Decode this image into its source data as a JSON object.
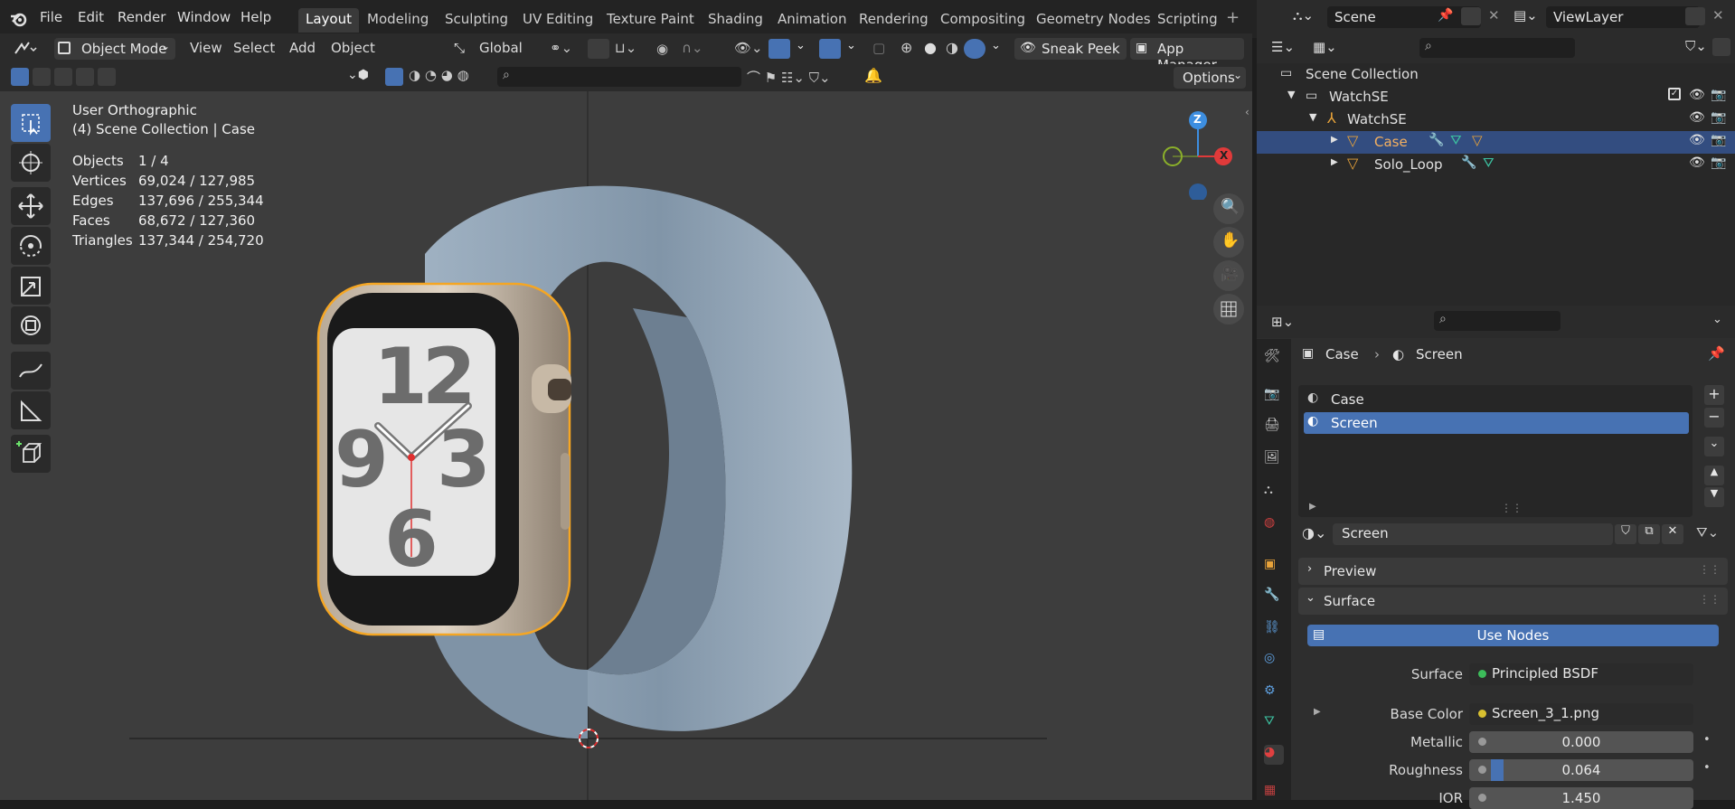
{
  "menu": [
    "File",
    "Edit",
    "Render",
    "Window",
    "Help"
  ],
  "workspaces": [
    "Layout",
    "Modeling",
    "Sculpting",
    "UV Editing",
    "Texture Paint",
    "Shading",
    "Animation",
    "Rendering",
    "Compositing",
    "Geometry Nodes",
    "Scripting"
  ],
  "active_workspace": "Layout",
  "scene": {
    "name": "Scene",
    "view_layer": "ViewLayer"
  },
  "viewport_header": {
    "mode": "Object Mode",
    "view": "View",
    "select": "Select",
    "add": "Add",
    "object": "Object",
    "transform": "Global",
    "sneak_peek": "Sneak Peek",
    "app_manager": "App Manager",
    "options": "Options"
  },
  "viewport_info": {
    "view_name": "User Orthographic",
    "collection": "(4) Scene Collection | Case",
    "stats": [
      {
        "label": "Objects",
        "value": "1 / 4"
      },
      {
        "label": "Vertices",
        "value": "69,024 / 127,985"
      },
      {
        "label": "Edges",
        "value": "137,696 / 255,344"
      },
      {
        "label": "Faces",
        "value": "68,672 / 127,360"
      },
      {
        "label": "Triangles",
        "value": "137,344 / 254,720"
      }
    ]
  },
  "gizmo": {
    "z": "Z",
    "x": "X"
  },
  "watch_face": {
    "n12": "12",
    "n9": "9",
    "n3": "3",
    "n6": "6"
  },
  "outliner": {
    "root": "Scene Collection",
    "rows": [
      "WatchSE",
      "WatchSE",
      "Case",
      "Solo_Loop"
    ]
  },
  "properties": {
    "breadcrumb_object": "Case",
    "breadcrumb_material": "Screen",
    "slots": [
      "Case",
      "Screen"
    ],
    "material_name": "Screen",
    "preview": "Preview",
    "surface_panel": "Surface",
    "use_nodes": "Use Nodes",
    "surface_label": "Surface",
    "surface_value": "Principled BSDF",
    "base_color_label": "Base Color",
    "base_color_value": "Screen_3_1.png",
    "metallic_label": "Metallic",
    "metallic_value": "0.000",
    "roughness_label": "Roughness",
    "roughness_value": "0.064",
    "ior_label": "IOR",
    "ior_value": "1.450"
  },
  "colors": {
    "accent": "#4772b3",
    "selection": "#f5a623",
    "background": "#3d3d3d"
  }
}
